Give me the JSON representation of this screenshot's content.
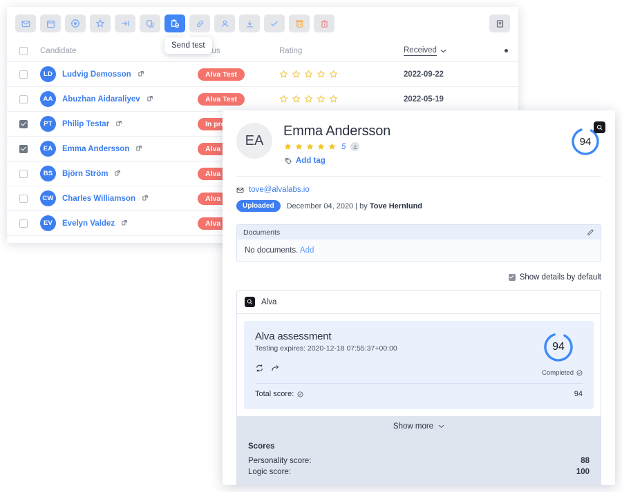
{
  "toolbar": {
    "buttons": [
      {
        "name": "email-icon",
        "label": "Email",
        "active": false
      },
      {
        "name": "calendar-icon",
        "label": "Schedule",
        "active": false
      },
      {
        "name": "target-icon",
        "label": "Source",
        "active": false
      },
      {
        "name": "star-icon",
        "label": "Rate",
        "active": false
      },
      {
        "name": "move-stage-icon",
        "label": "Move stage",
        "active": false
      },
      {
        "name": "copy-icon",
        "label": "Copy",
        "active": false
      },
      {
        "name": "send-test-icon",
        "label": "Send test",
        "active": true
      },
      {
        "name": "link-icon",
        "label": "Link",
        "active": false
      },
      {
        "name": "person-icon",
        "label": "Assign",
        "active": false
      },
      {
        "name": "download-icon",
        "label": "Download",
        "active": false
      },
      {
        "name": "check-icon",
        "label": "Approve",
        "active": false
      },
      {
        "name": "archive-icon",
        "label": "Archive",
        "active": false
      },
      {
        "name": "delete-icon",
        "label": "Delete",
        "active": false
      }
    ],
    "export_label": "Export",
    "tooltip": "Send test"
  },
  "table": {
    "columns": [
      "",
      "Candidate",
      "Status",
      "Rating",
      "Received",
      ""
    ],
    "sort_column": "Received",
    "rows": [
      {
        "initials": "LD",
        "name": "Ludvig Demosson",
        "status": "Alva Test",
        "rating": 0,
        "received": "2022-09-22",
        "selected": false
      },
      {
        "initials": "AA",
        "name": "Abuzhan Aidaraliyev",
        "status": "Alva Test",
        "rating": 0,
        "received": "2022-05-19",
        "selected": false
      },
      {
        "initials": "PT",
        "name": "Philip Testar",
        "status": "In progress",
        "rating": 0,
        "received": "",
        "selected": true
      },
      {
        "initials": "EA",
        "name": "Emma Andersson",
        "status": "Alva Test",
        "rating": 0,
        "received": "",
        "selected": true
      },
      {
        "initials": "BS",
        "name": "Björn Ström",
        "status": "Alva Test",
        "rating": 0,
        "received": "",
        "selected": false
      },
      {
        "initials": "CW",
        "name": "Charles Williamson",
        "status": "Alva Test",
        "rating": 0,
        "received": "",
        "selected": false
      },
      {
        "initials": "EV",
        "name": "Evelyn Valdez",
        "status": "Alva Test",
        "rating": 0,
        "received": "",
        "selected": false
      }
    ]
  },
  "detail": {
    "initials": "EA",
    "name": "Emma Andersson",
    "rating": 5,
    "rating_label": "5",
    "add_tag_label": "Add tag",
    "score_ring": "94",
    "email": "tove@alvalabs.io",
    "upload_badge": "Uploaded",
    "upload_date": "December 04, 2020 | by ",
    "upload_by": "Tove Hernlund",
    "documents": {
      "header": "Documents",
      "empty_text": "No documents. ",
      "add_link": "Add"
    },
    "show_details_label": "Show details by default",
    "alva": {
      "provider": "Alva",
      "title": "Alva assessment",
      "expires": "Testing expires: 2020-12-18 07:55:37+00:00",
      "score": "94",
      "completed_label": "Completed",
      "total_score_label": "Total score:",
      "total_score_value": "94",
      "show_more_label": "Show more",
      "scores_title": "Scores",
      "scores": [
        {
          "label": "Personality score:",
          "value": "88"
        },
        {
          "label": "Logic score:",
          "value": "100"
        }
      ]
    }
  },
  "colors": {
    "accent_blue": "#3d7ef0",
    "badge_red": "#f4736b",
    "star_gold": "#f5c52b",
    "archive_orange": "#f0ad4e",
    "delete_red": "#f2868a"
  }
}
